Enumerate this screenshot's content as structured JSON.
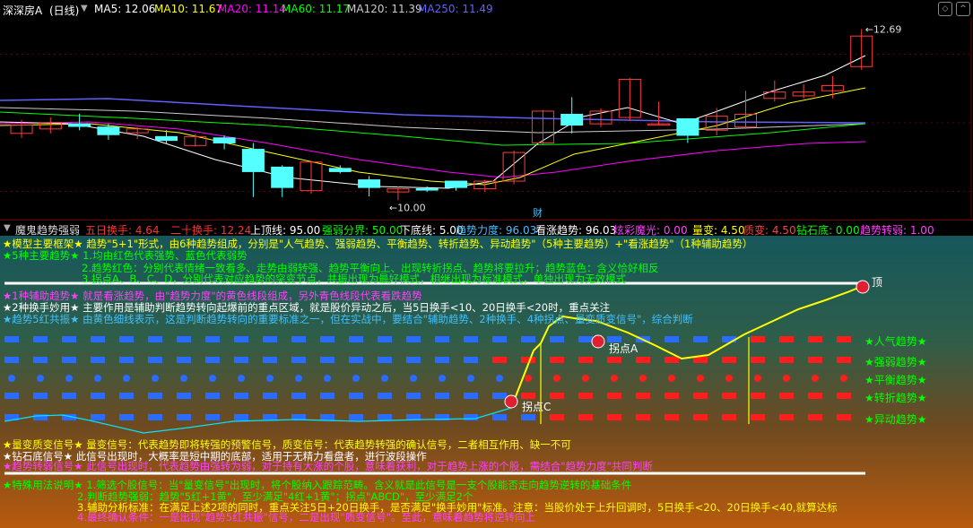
{
  "header": {
    "stock": "深深房A",
    "period": "(日线)",
    "ma": [
      {
        "label": "MA5: 12.06",
        "color": "#ffffff"
      },
      {
        "label": "MA10: 11.67",
        "color": "#ffff00"
      },
      {
        "label": "MA20: 11.14",
        "color": "#ff00ff"
      },
      {
        "label": "MA60: 11.17",
        "color": "#00ff00"
      },
      {
        "label": "MA120: 11.39",
        "color": "#cccccc"
      },
      {
        "label": "MA250: 11.49",
        "color": "#6060ff"
      }
    ]
  },
  "chart_data": {
    "type": "candlestick",
    "high_label": "12.69",
    "low_label": "10.00",
    "marker": "财",
    "ylim": [
      9.85,
      12.78
    ],
    "candles": [
      {
        "o": 11.05,
        "c": 11.18,
        "h": 11.26,
        "l": 10.98
      },
      {
        "o": 11.12,
        "c": 11.22,
        "h": 11.3,
        "l": 11.05
      },
      {
        "o": 11.2,
        "c": 11.16,
        "h": 11.36,
        "l": 11.1
      },
      {
        "o": 11.15,
        "c": 11.03,
        "h": 11.2,
        "l": 10.95
      },
      {
        "o": 11.06,
        "c": 11.12,
        "h": 11.15,
        "l": 10.96
      },
      {
        "o": 11.0,
        "c": 10.94,
        "h": 11.1,
        "l": 10.88
      },
      {
        "o": 10.86,
        "c": 11.0,
        "h": 11.04,
        "l": 10.84
      },
      {
        "o": 10.98,
        "c": 10.9,
        "h": 11.02,
        "l": 10.8
      },
      {
        "o": 10.8,
        "c": 10.45,
        "h": 10.9,
        "l": 10.05
      },
      {
        "o": 10.52,
        "c": 10.2,
        "h": 10.55,
        "l": 10.05
      },
      {
        "o": 10.15,
        "c": 10.6,
        "h": 10.62,
        "l": 10.1
      },
      {
        "o": 10.5,
        "c": 10.45,
        "h": 10.55,
        "l": 10.42
      },
      {
        "o": 10.32,
        "c": 10.2,
        "h": 10.38,
        "l": 10.06
      },
      {
        "o": 10.13,
        "c": 10.18,
        "h": 10.22,
        "l": 10.0
      },
      {
        "o": 10.18,
        "c": 10.17,
        "h": 10.22,
        "l": 10.13
      },
      {
        "o": 10.3,
        "c": 10.2,
        "h": 10.3,
        "l": 10.15
      },
      {
        "o": 10.18,
        "c": 10.3,
        "h": 10.32,
        "l": 10.13
      },
      {
        "o": 10.3,
        "c": 10.75,
        "h": 10.78,
        "l": 10.25
      },
      {
        "o": 10.9,
        "c": 11.4,
        "h": 11.42,
        "l": 10.88
      },
      {
        "o": 11.35,
        "c": 11.18,
        "h": 11.62,
        "l": 11.05
      },
      {
        "o": 11.2,
        "c": 11.4,
        "h": 11.44,
        "l": 11.15
      },
      {
        "o": 11.3,
        "c": 11.9,
        "h": 11.92,
        "l": 11.25
      },
      {
        "o": 11.2,
        "c": 11.2,
        "h": 11.55,
        "l": 11.18
      },
      {
        "o": 11.28,
        "c": 11.02,
        "h": 11.28,
        "l": 10.9
      },
      {
        "o": 11.1,
        "c": 11.32,
        "h": 11.45,
        "l": 11.02
      },
      {
        "o": 11.15,
        "c": 11.35,
        "h": 11.72,
        "l": 11.12
      },
      {
        "o": 11.6,
        "c": 11.7,
        "h": 11.88,
        "l": 11.55
      },
      {
        "o": 11.64,
        "c": 11.7,
        "h": 11.82,
        "l": 11.6
      },
      {
        "o": 11.72,
        "c": 11.8,
        "h": 11.95,
        "l": 11.6
      },
      {
        "o": 12.1,
        "c": 12.58,
        "h": 12.69,
        "l": 12.05
      }
    ]
  },
  "indicator_header": {
    "name": "魔鬼趋势强弱",
    "items": [
      {
        "label": "五日换手: 4.64",
        "color": "#ff3030"
      },
      {
        "label": "二十换手: 12.24",
        "color": "#ff3030"
      },
      {
        "label": "上顶线: 95.00",
        "color": "#ffffff"
      },
      {
        "label": "强弱分界: 50.00",
        "color": "#00ff00"
      },
      {
        "label": "下底线: 5.00",
        "color": "#ffffff"
      },
      {
        "label": "趋势力度: 96.03",
        "color": "#40c0ff"
      },
      {
        "label": "看涨趋势: 96.03",
        "color": "#ffffff"
      },
      {
        "label": "炫彩魔光: 0.00",
        "color": "#ff40ff"
      },
      {
        "label": "量变: 4.50",
        "color": "#ffff00"
      },
      {
        "label": "质变: 4.50",
        "color": "#ff4040"
      },
      {
        "label": "钻石底: 0.00",
        "color": "#00ff00"
      },
      {
        "label": "趋势转弱: 1.00",
        "color": "#ff40ff"
      }
    ]
  },
  "notes": {
    "l1": "★模型主要框架★ 趋势\"5+1\"形式，由6种趋势组成，分别是\"人气趋势、强弱趋势、平衡趋势、转折趋势、异动趋势\"（5种主要趋势）+\"看涨趋势\"（1种辅助趋势）",
    "l2": "★5种主要趋势★ 1.均由红色代表强势、蓝色代表弱势",
    "l3": "2.趋势红色：分别代表情绪一致看多、走势由弱转强、趋势平衡向上、出现转折拐点、趋势将要拉升；趋势蓝色：含义恰好相反",
    "l4": "3.拐点A、B、C、D，分别代表对应趋势的突变节点，共振出现为最好模式，相继出现为标准模式，单独出现为无效模式",
    "l5": "★1种辅助趋势★ 就是看涨趋势，由\"趋势力度\"的黄色线段组成，另外青色线段代表看跌趋势",
    "l6": "★2种换手妙用★ 主要作用是辅助判断趋势转向起爆前的重点区域，就是股价异动之后，当5日换手<10、20日换手<20时，重点关注",
    "l7": "★趋势5红共振★ 由黄色细线表示，这是判断趋势转向的重要标准之一，但在实战中，要结合\"辅助趋势、2种换手、4种拐点、量变质变信号\"，综合判断",
    "l8": "★量变质变信号★ 量变信号：代表趋势即将转强的预警信号，质变信号：代表趋势转强的确认信号，二者相互作用、缺一不可",
    "l9": "★钻石底信号★ 此信号出现时，大概率是短中期的底部，适用于无精力看盘者，进行波段操作",
    "l10": "★趋势转弱信号★ 此信号出现时，代表趋势由强转为弱，对于持有大涨的个股，意味着获利，对于趋势上涨的个股，需结合\"趋势力度\"共同判断",
    "l11": "★特殊用法说明★ 1.筛选个股信号：当\"量变信号\"出现时，将个股纳入跟踪范畴。含义就是此信号是一支个股能否走向趋势逆转的基础条件",
    "l12": "2.判断趋势强弱：趋势\"5红+1黄\"，至少满足\"4红+1黄\"；拐点\"ABCD\"，至少满足2个",
    "l13": "3.辅助分析标准：在满足上述2项的同时，重点关注5日+20日换手，是否满足\"换手妙用\"标准。注意：当股价处于上升回调时，5日换手<20、20日换手<40,就算达标",
    "l14": "4.最终确认条件：一是出现\"趋势5红共振\"信号，二是出现\"质变信号\"。至此，意味着趋势将逆转向上"
  },
  "trend_labels": [
    "★人气趋势★",
    "★强弱趋势★",
    "★平衡趋势★",
    "★转折趋势★",
    "★异动趋势★"
  ],
  "turn_points": {
    "top": "顶",
    "a": "拐点A",
    "c": "拐点C"
  }
}
